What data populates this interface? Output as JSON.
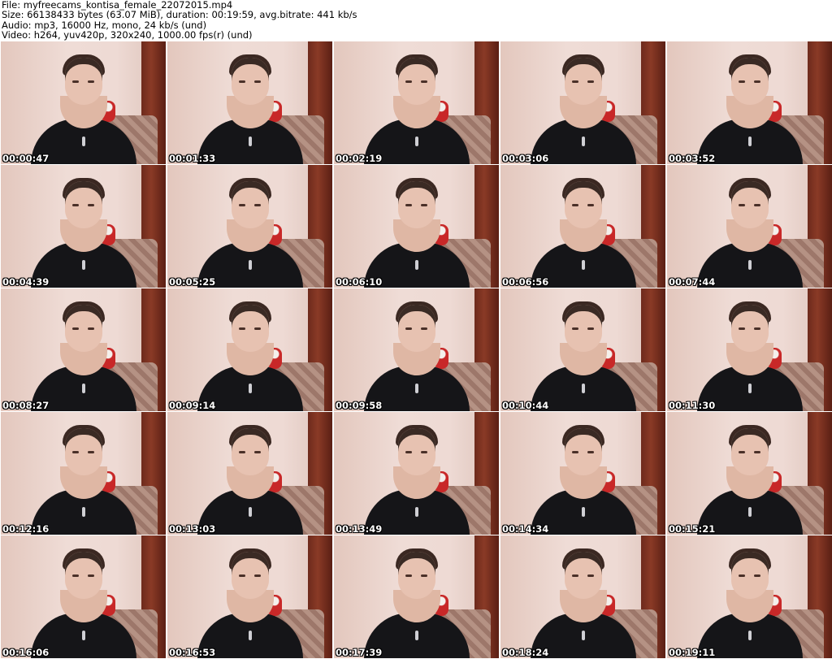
{
  "header": {
    "file": "File: myfreecams_kontisa_female_22072015.mp4",
    "size": "Size: 66138433 bytes (63.07 MiB), duration: 00:19:59, avg.bitrate: 441 kb/s",
    "audio": "Audio: mp3, 16000 Hz, mono, 24 kb/s (und)",
    "video": "Video: h264, yuv420p, 320x240, 1000.00 fps(r) (und)"
  },
  "thumbnails": [
    {
      "timestamp": "00:00:47"
    },
    {
      "timestamp": "00:01:33"
    },
    {
      "timestamp": "00:02:19"
    },
    {
      "timestamp": "00:03:06"
    },
    {
      "timestamp": "00:03:52"
    },
    {
      "timestamp": "00:04:39"
    },
    {
      "timestamp": "00:05:25"
    },
    {
      "timestamp": "00:06:10"
    },
    {
      "timestamp": "00:06:56"
    },
    {
      "timestamp": "00:07:44"
    },
    {
      "timestamp": "00:08:27"
    },
    {
      "timestamp": "00:09:14"
    },
    {
      "timestamp": "00:09:58"
    },
    {
      "timestamp": "00:10:44"
    },
    {
      "timestamp": "00:11:30"
    },
    {
      "timestamp": "00:12:16"
    },
    {
      "timestamp": "00:13:03"
    },
    {
      "timestamp": "00:13:49"
    },
    {
      "timestamp": "00:14:34"
    },
    {
      "timestamp": "00:15:21"
    },
    {
      "timestamp": "00:16:06"
    },
    {
      "timestamp": "00:16:53"
    },
    {
      "timestamp": "00:17:39"
    },
    {
      "timestamp": "00:18:24"
    },
    {
      "timestamp": "00:19:11"
    }
  ]
}
